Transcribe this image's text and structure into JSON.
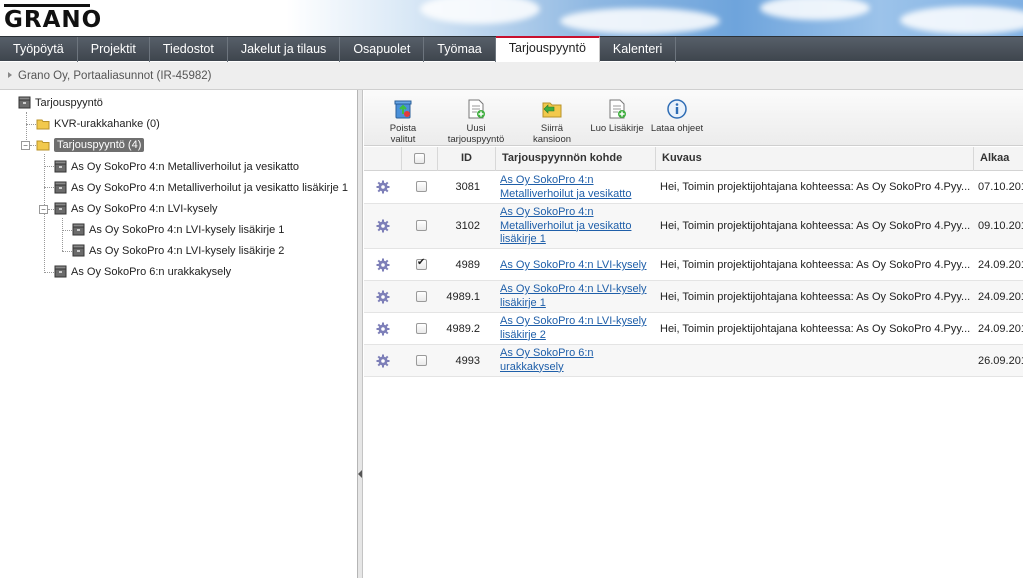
{
  "brand": {
    "logo_text": "GRANO"
  },
  "nav": {
    "tabs": [
      "Työpöytä",
      "Projektit",
      "Tiedostot",
      "Jakelut ja tilaus",
      "Osapuolet",
      "Työmaa",
      "Tarjouspyyntö",
      "Kalenteri"
    ],
    "active": "Tarjouspyyntö"
  },
  "breadcrumb": {
    "text": "Grano Oy, Portaaliasunnot (IR-45982)"
  },
  "tree": {
    "root": "Tarjouspyyntö",
    "kvr": "KVR-urakkahanke (0)",
    "tarjous_folder": "Tarjouspyyntö (4)",
    "items": [
      "As Oy SokoPro 4:n Metalliverhoilut ja vesikatto",
      "As Oy SokoPro 4:n Metalliverhoilut ja vesikatto lisäkirje 1",
      "As Oy SokoPro 4:n LVI-kysely",
      "As Oy SokoPro 4:n LVI-kysely lisäkirje 1",
      "As Oy SokoPro 4:n LVI-kysely lisäkirje 2",
      "As Oy SokoPro 6:n urakkakysely"
    ]
  },
  "toolbar": {
    "delete": "Poista valitut",
    "new": "Uusi tarjouspyyntö",
    "move": "Siirrä kansioon",
    "addendum": "Luo Lisäkirje",
    "guide": "Lataa ohjeet"
  },
  "grid": {
    "headers": {
      "id": "ID",
      "target": "Tarjouspyynnön kohde",
      "desc": "Kuvaus",
      "start": "Alkaa"
    },
    "rows": [
      {
        "id": "3081",
        "target": "As Oy SokoPro 4:n Metalliverhoilut ja vesikatto",
        "desc": "Hei, Toimin projektijohtajana kohteessa: As Oy SokoPro 4.Pyy...",
        "start": "07.10.201",
        "checked": false
      },
      {
        "id": "3102",
        "target": "As Oy SokoPro 4:n Metalliverhoilut ja vesikatto lisäkirje 1",
        "desc": "Hei, Toimin projektijohtajana kohteessa: As Oy SokoPro 4.Pyy...",
        "start": "09.10.201",
        "checked": false
      },
      {
        "id": "4989",
        "target": "As Oy SokoPro 4:n LVI-kysely",
        "desc": "Hei, Toimin projektijohtajana kohteessa: As Oy SokoPro 4.Pyy...",
        "start": "24.09.201",
        "checked": true
      },
      {
        "id": "4989.1",
        "target": "As Oy SokoPro 4:n LVI-kysely lisäkirje 1",
        "desc": "Hei, Toimin projektijohtajana kohteessa: As Oy SokoPro 4.Pyy...",
        "start": "24.09.201",
        "checked": false
      },
      {
        "id": "4989.2",
        "target": "As Oy SokoPro 4:n LVI-kysely lisäkirje 2",
        "desc": "Hei, Toimin projektijohtajana kohteessa: As Oy SokoPro 4.Pyy...",
        "start": "24.09.201",
        "checked": false
      },
      {
        "id": "4993",
        "target": "As Oy SokoPro 6:n urakkakysely",
        "desc": "",
        "start": "26.09.201",
        "checked": false
      }
    ]
  },
  "colors": {
    "active_tab_accent": "#c8102e",
    "link": "#1f5fa9",
    "nav_bg": "#4a5159"
  }
}
